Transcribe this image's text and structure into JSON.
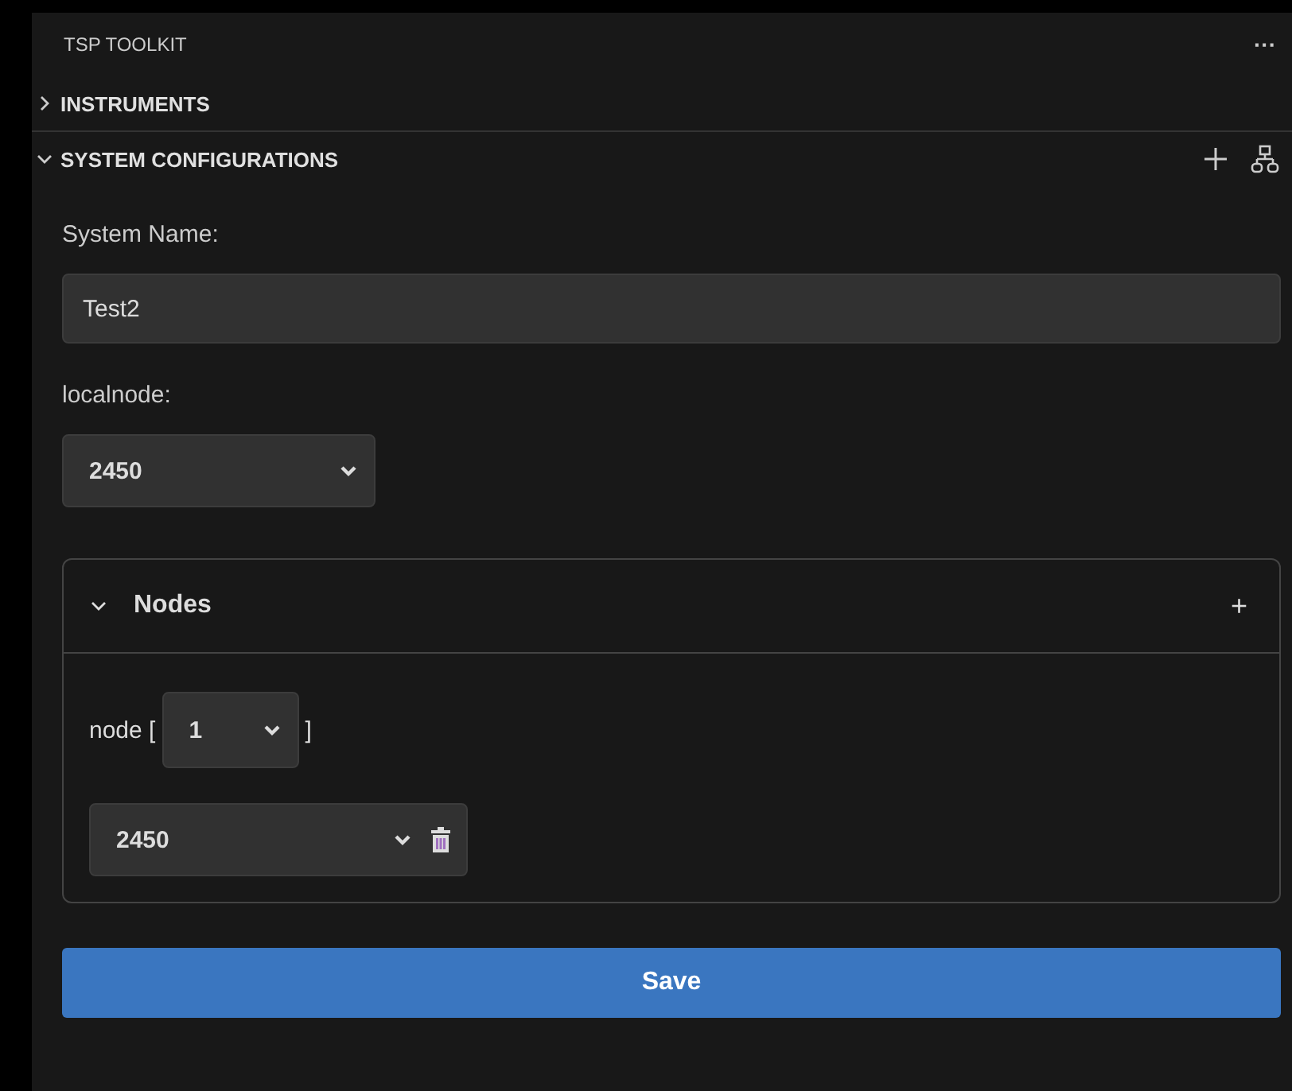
{
  "header": {
    "title": "TSP TOOLKIT",
    "more": "···"
  },
  "sections": [
    {
      "title": "INSTRUMENTS",
      "expanded": false
    },
    {
      "title": "SYSTEM CONFIGURATIONS",
      "expanded": true
    }
  ],
  "form": {
    "system_name_label": "System Name:",
    "system_name": "Test2",
    "localnode_label": "localnode:",
    "localnode": "2450",
    "nodes": {
      "title": "Nodes",
      "expanded": true,
      "add": "+",
      "node_label": "node [",
      "node_close": "]",
      "node_index": "1",
      "node_model": "2450"
    },
    "save": "Save"
  }
}
